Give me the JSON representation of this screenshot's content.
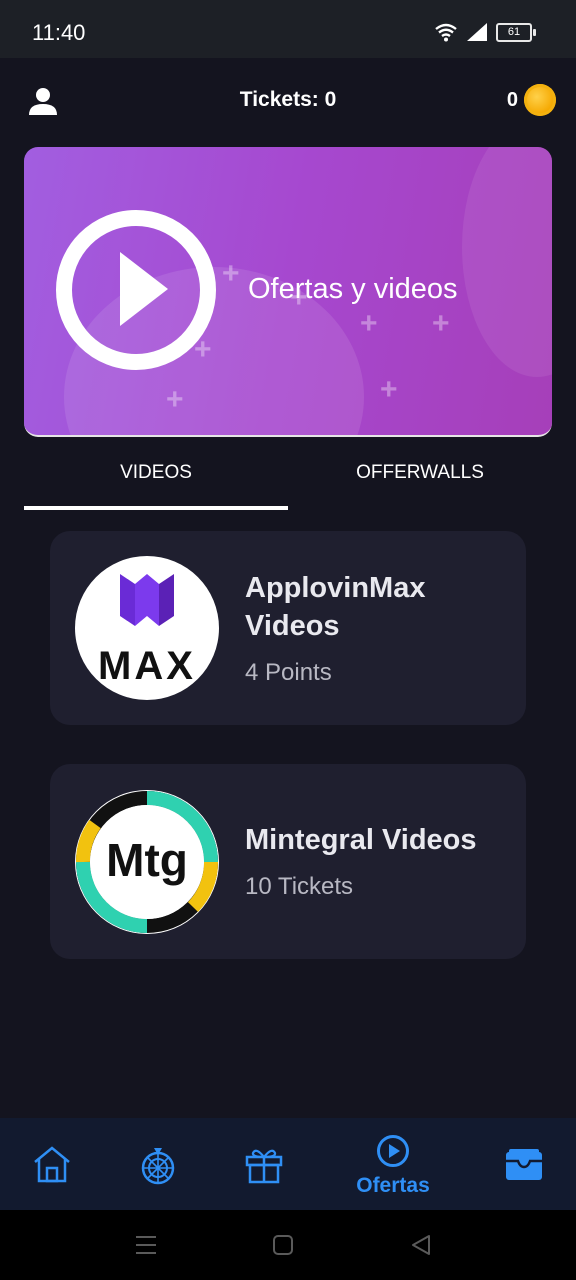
{
  "status_bar": {
    "time": "11:40",
    "battery_level": "61"
  },
  "header": {
    "tickets_label": "Tickets: 0",
    "coin_count": "0"
  },
  "banner": {
    "title": "Ofertas y videos"
  },
  "tabs": [
    {
      "label": "VIDEOS",
      "active": true
    },
    {
      "label": "OFFERWALLS",
      "active": false
    }
  ],
  "cards": [
    {
      "logo_text": "MAX",
      "title": "ApplovinMax Videos",
      "title_lines": [
        "ApplovinMax",
        "Videos"
      ],
      "subtitle": "4 Points"
    },
    {
      "logo_text": "Mtg",
      "title": "Mintegral Videos",
      "subtitle": "10 Tickets"
    }
  ],
  "bottom_nav": {
    "items": [
      {
        "icon": "home-icon"
      },
      {
        "icon": "wheel-icon"
      },
      {
        "icon": "gift-icon"
      },
      {
        "icon": "play-circle-icon",
        "label": "Ofertas",
        "active": true
      },
      {
        "icon": "wallet-icon"
      }
    ],
    "active_color": "#2f8ff5"
  },
  "colors": {
    "accent": "#2f8ff5",
    "banner": "#a648cf",
    "card": "#1f1f2f",
    "background": "#14141f"
  }
}
